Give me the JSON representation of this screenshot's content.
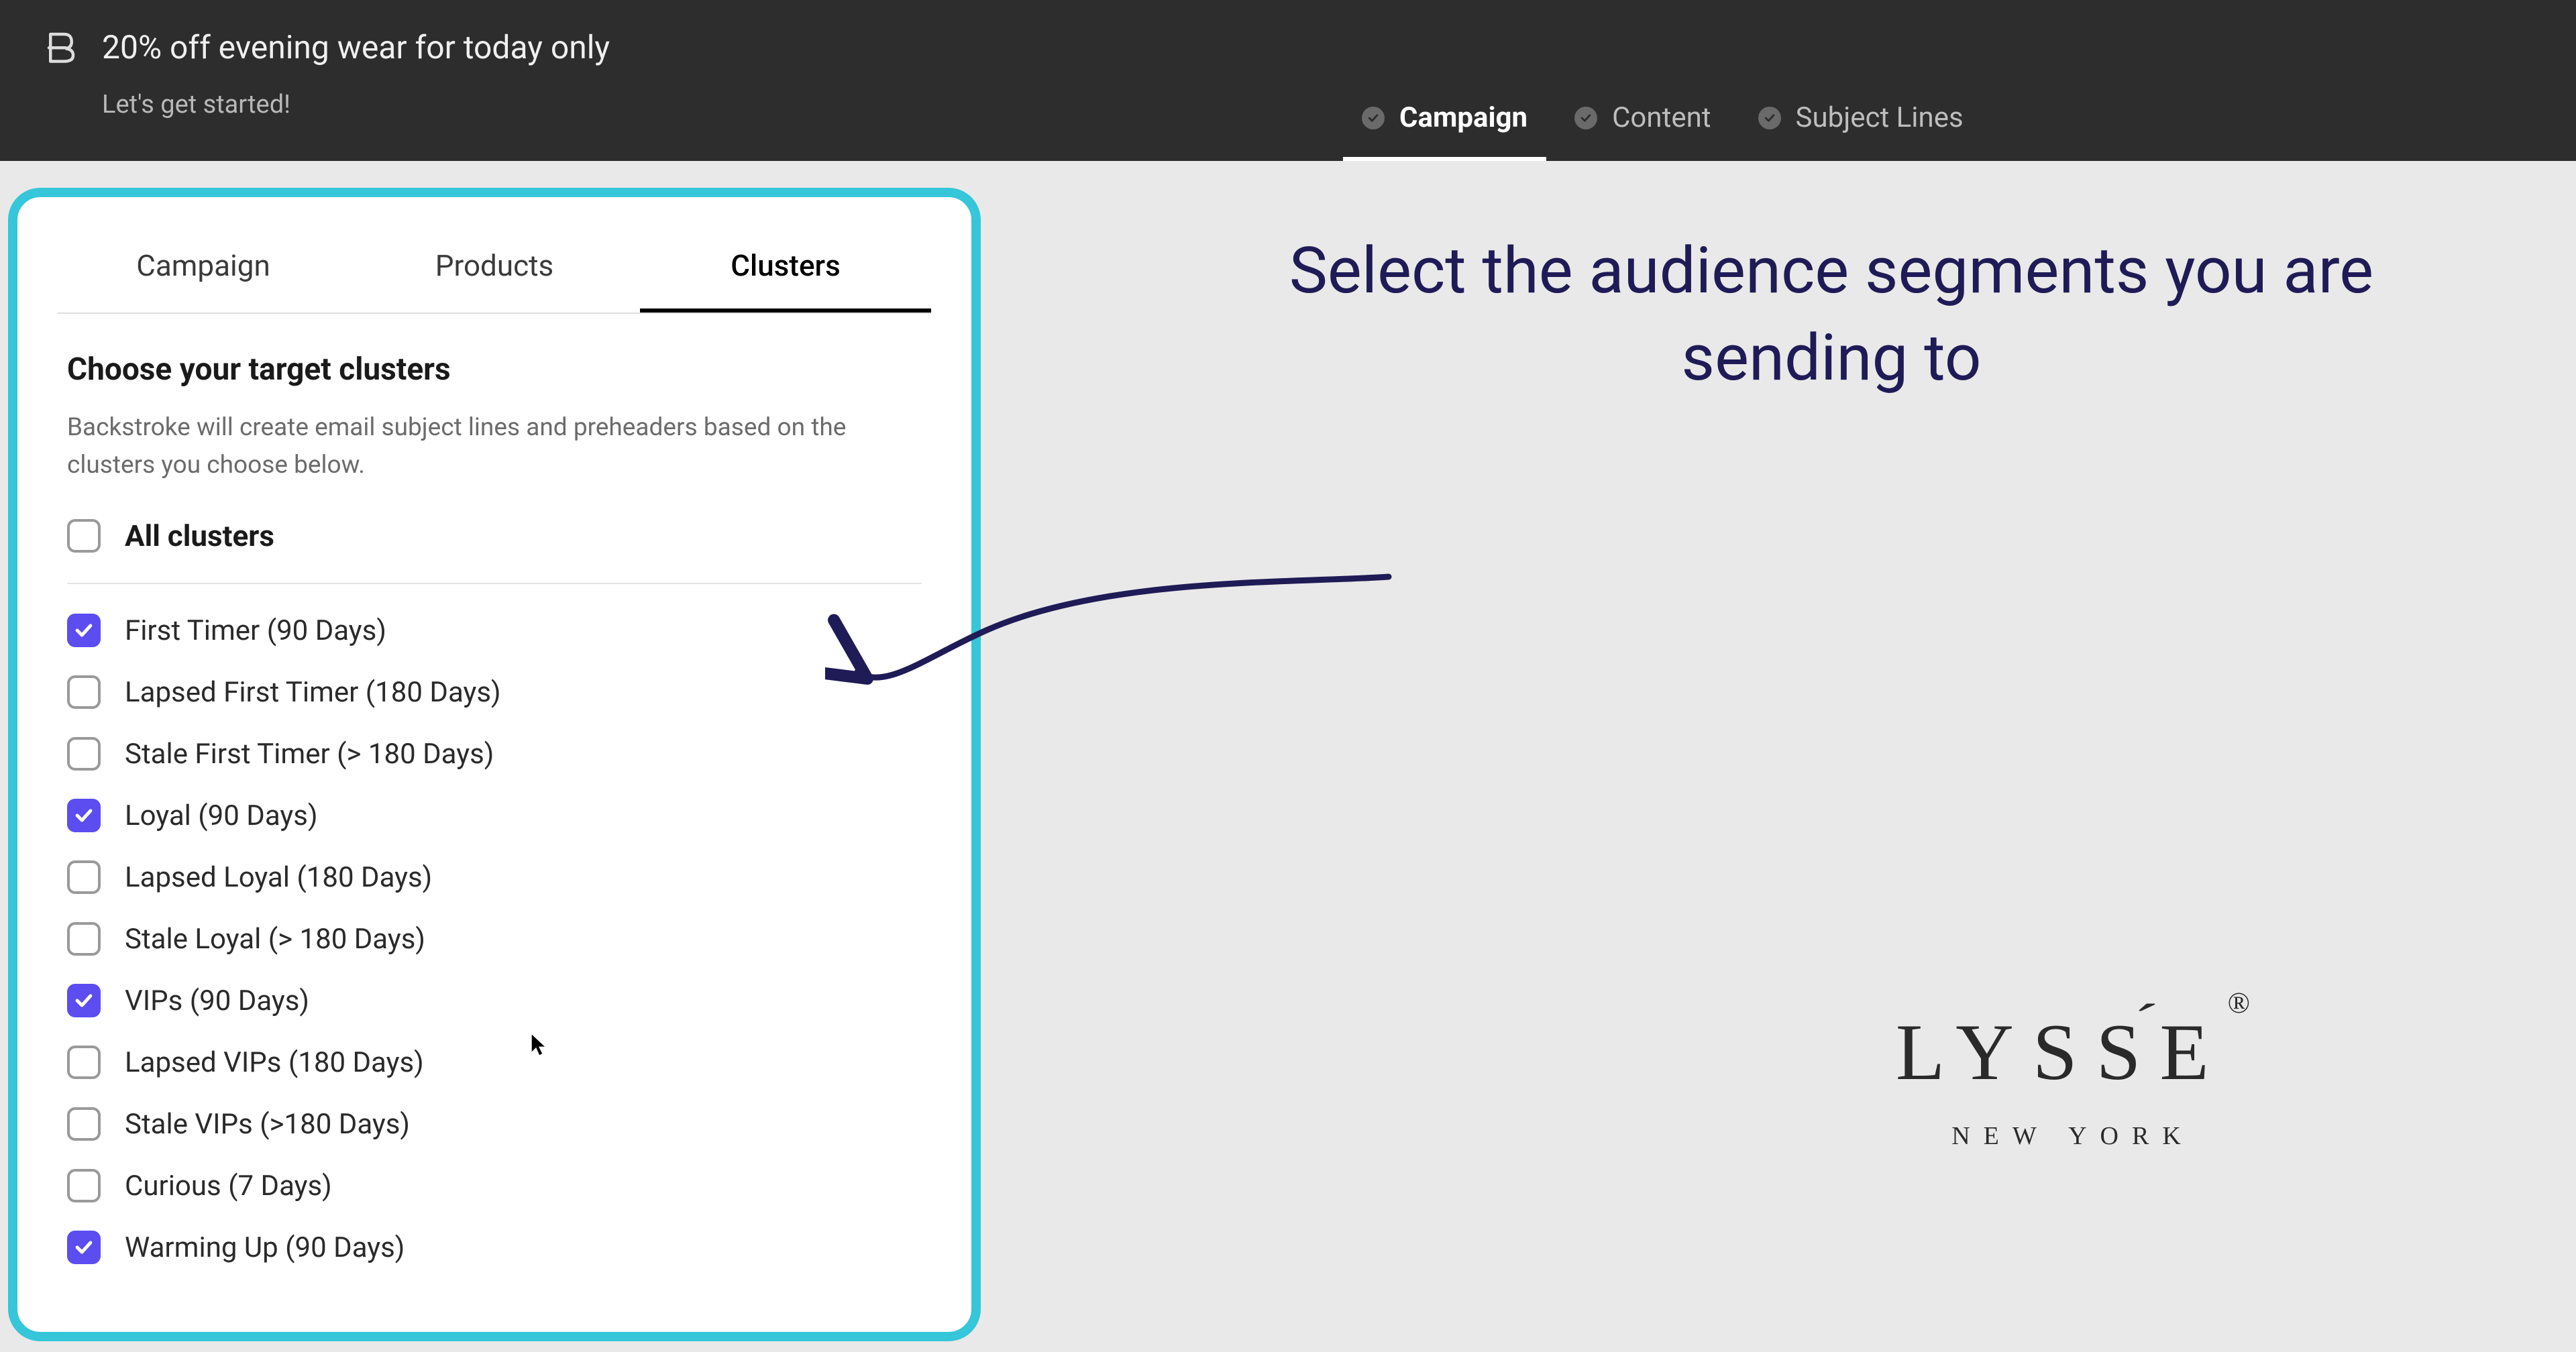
{
  "header": {
    "title": "20% off evening wear for today only",
    "subtitle": "Let's get started!"
  },
  "steps": [
    {
      "label": "Campaign",
      "active": true
    },
    {
      "label": "Content",
      "active": false
    },
    {
      "label": "Subject Lines",
      "active": false
    }
  ],
  "panel": {
    "tabs": [
      {
        "label": "Campaign",
        "active": false
      },
      {
        "label": "Products",
        "active": false
      },
      {
        "label": "Clusters",
        "active": true
      }
    ],
    "heading": "Choose your target clusters",
    "description": "Backstroke will create email subject lines and preheaders based on the clusters you choose below.",
    "all_label": "All clusters",
    "all_checked": false,
    "clusters": [
      {
        "label": "First Timer (90 Days)",
        "checked": true
      },
      {
        "label": "Lapsed First Timer (180 Days)",
        "checked": false
      },
      {
        "label": "Stale First Timer (> 180 Days)",
        "checked": false
      },
      {
        "label": "Loyal (90 Days)",
        "checked": true
      },
      {
        "label": "Lapsed Loyal (180 Days)",
        "checked": false
      },
      {
        "label": "Stale Loyal (> 180 Days)",
        "checked": false
      },
      {
        "label": "VIPs (90 Days)",
        "checked": true
      },
      {
        "label": "Lapsed VIPs (180 Days)",
        "checked": false
      },
      {
        "label": "Stale VIPs (>180 Days)",
        "checked": false
      },
      {
        "label": "Curious (7 Days)",
        "checked": false
      },
      {
        "label": "Warming Up (90 Days)",
        "checked": true
      }
    ]
  },
  "annotation": {
    "text": "Select the audience segments you are sending to"
  },
  "brand": {
    "name": "LYSSÉ",
    "plain": "LYSSE",
    "registered": "®",
    "city": "NEW YORK"
  }
}
